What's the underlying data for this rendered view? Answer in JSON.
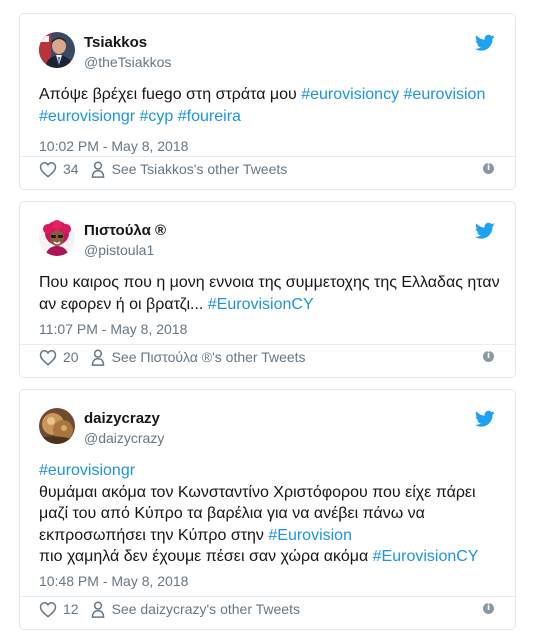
{
  "colors": {
    "link": "#1b95e0",
    "muted": "#657786",
    "twitter_blue": "#1da1f2"
  },
  "tweets": [
    {
      "name": "Tsiakkos",
      "handle": "@theTsiakkos",
      "text": [
        {
          "t": "Απόψε βρέχει fuego στη στράτα μου "
        },
        {
          "t": "#eurovisioncy",
          "tag": true
        },
        {
          "t": " "
        },
        {
          "t": "#eurovision",
          "tag": true
        },
        {
          "t": " "
        },
        {
          "t": "#eurovisiongr",
          "tag": true
        },
        {
          "t": " "
        },
        {
          "t": "#cyp",
          "tag": true
        },
        {
          "t": " "
        },
        {
          "t": "#foureira",
          "tag": true
        }
      ],
      "time": "10:02 PM - May 8, 2018",
      "likes": "34",
      "other_tweets": "See Tsiakkos's other Tweets",
      "avatar": "avatar-man-suit"
    },
    {
      "name": "Πιστούλα ®",
      "handle": "@pistoula1",
      "text": [
        {
          "t": "Που καιρος που η μονη εννοια της συμμετοχης της Ελλαδας ηταν αν εφορεν ή οι βρατζι... "
        },
        {
          "t": "#EurovisionCY",
          "tag": true
        }
      ],
      "time": "11:07 PM - May 8, 2018",
      "likes": "20",
      "other_tweets": "See Πιστούλα ®'s other Tweets",
      "avatar": "avatar-woman-pink"
    },
    {
      "name": "daizycrazy",
      "handle": "@daizycrazy",
      "text": [
        {
          "t": "#eurovisiongr",
          "tag": true
        },
        {
          "t": "\nθυμάμαι ακόμα τον Κωνσταντίνο Χριστόφορου που είχε πάρει μαζί του από Κύπρο τα βαρέλια για να ανέβει πάνω να εκπροσωπήσει την Κύπρο στην "
        },
        {
          "t": "#Eurovision",
          "tag": true
        },
        {
          "t": "\nπιο χαμηλά δεν έχουμε πέσει σαν χώρα ακόμα "
        },
        {
          "t": "#EurovisionCY",
          "tag": true
        }
      ],
      "time": "10:48 PM - May 8, 2018",
      "likes": "12",
      "other_tweets": "See daizycrazy's other Tweets",
      "avatar": "avatar-food"
    }
  ]
}
